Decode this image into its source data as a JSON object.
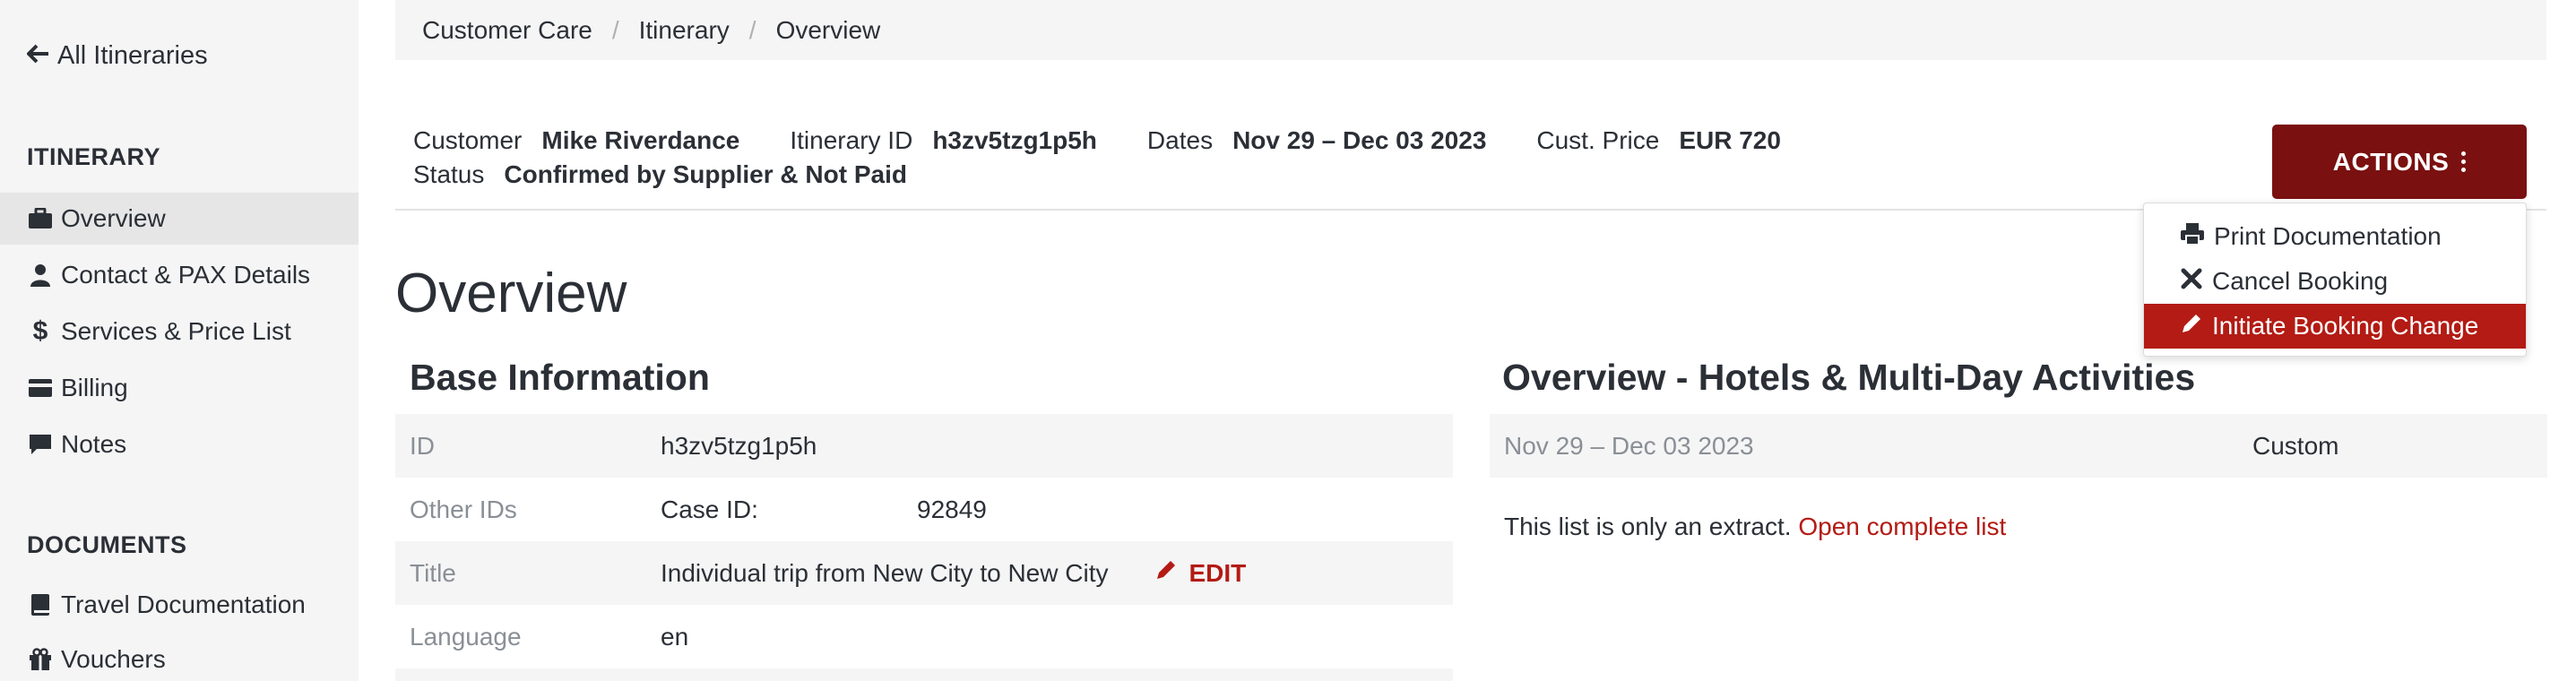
{
  "sidebar": {
    "back_label": "All Itineraries",
    "itinerary_heading": "ITINERARY",
    "itinerary_items": [
      {
        "label": "Overview",
        "icon": "briefcase-icon"
      },
      {
        "label": "Contact & PAX Details",
        "icon": "user-icon"
      },
      {
        "label": "Services & Price List",
        "icon": "dollar-icon"
      },
      {
        "label": "Billing",
        "icon": "credit-card-icon"
      },
      {
        "label": "Notes",
        "icon": "comment-icon"
      }
    ],
    "documents_heading": "DOCUMENTS",
    "document_items": [
      {
        "label": "Travel Documentation",
        "icon": "book-icon"
      },
      {
        "label": "Vouchers",
        "icon": "gift-icon"
      }
    ]
  },
  "breadcrumb": [
    "Customer Care",
    "Itinerary",
    "Overview"
  ],
  "summary": {
    "customer_label": "Customer",
    "customer_value": "Mike Riverdance",
    "itinerary_id_label": "Itinerary ID",
    "itinerary_id_value": "h3zv5tzg1p5h",
    "dates_label": "Dates",
    "dates_value": "Nov 29 – Dec 03 2023",
    "price_label": "Cust. Price",
    "price_value": "EUR 720",
    "status_label": "Status",
    "status_value": "Confirmed by Supplier & Not Paid"
  },
  "actions": {
    "button_label": "ACTIONS",
    "menu": [
      {
        "label": "Print Documentation",
        "icon": "print-icon"
      },
      {
        "label": "Cancel Booking",
        "icon": "close-icon"
      },
      {
        "label": "Initiate Booking Change",
        "icon": "pencil-icon"
      }
    ]
  },
  "page_title": "Overview",
  "base_info": {
    "title": "Base Information",
    "rows": {
      "id_label": "ID",
      "id_value": "h3zv5tzg1p5h",
      "other_ids_label": "Other IDs",
      "case_id_label": "Case ID:",
      "case_id_value": "92849",
      "title_label": "Title",
      "title_value": "Individual trip from New City to New City",
      "edit_label": "EDIT",
      "language_label": "Language",
      "language_value": "en"
    }
  },
  "hotels": {
    "title": "Overview - Hotels & Multi-Day Activities",
    "row_date": "Nov 29 – Dec 03 2023",
    "row_type": "Custom",
    "extract_text": "This list is only an extract.",
    "open_list_link": "Open complete list"
  },
  "colors": {
    "accent_dark": "#7a1010",
    "accent": "#b31b14",
    "sidebar_bg": "#f5f5f5"
  }
}
